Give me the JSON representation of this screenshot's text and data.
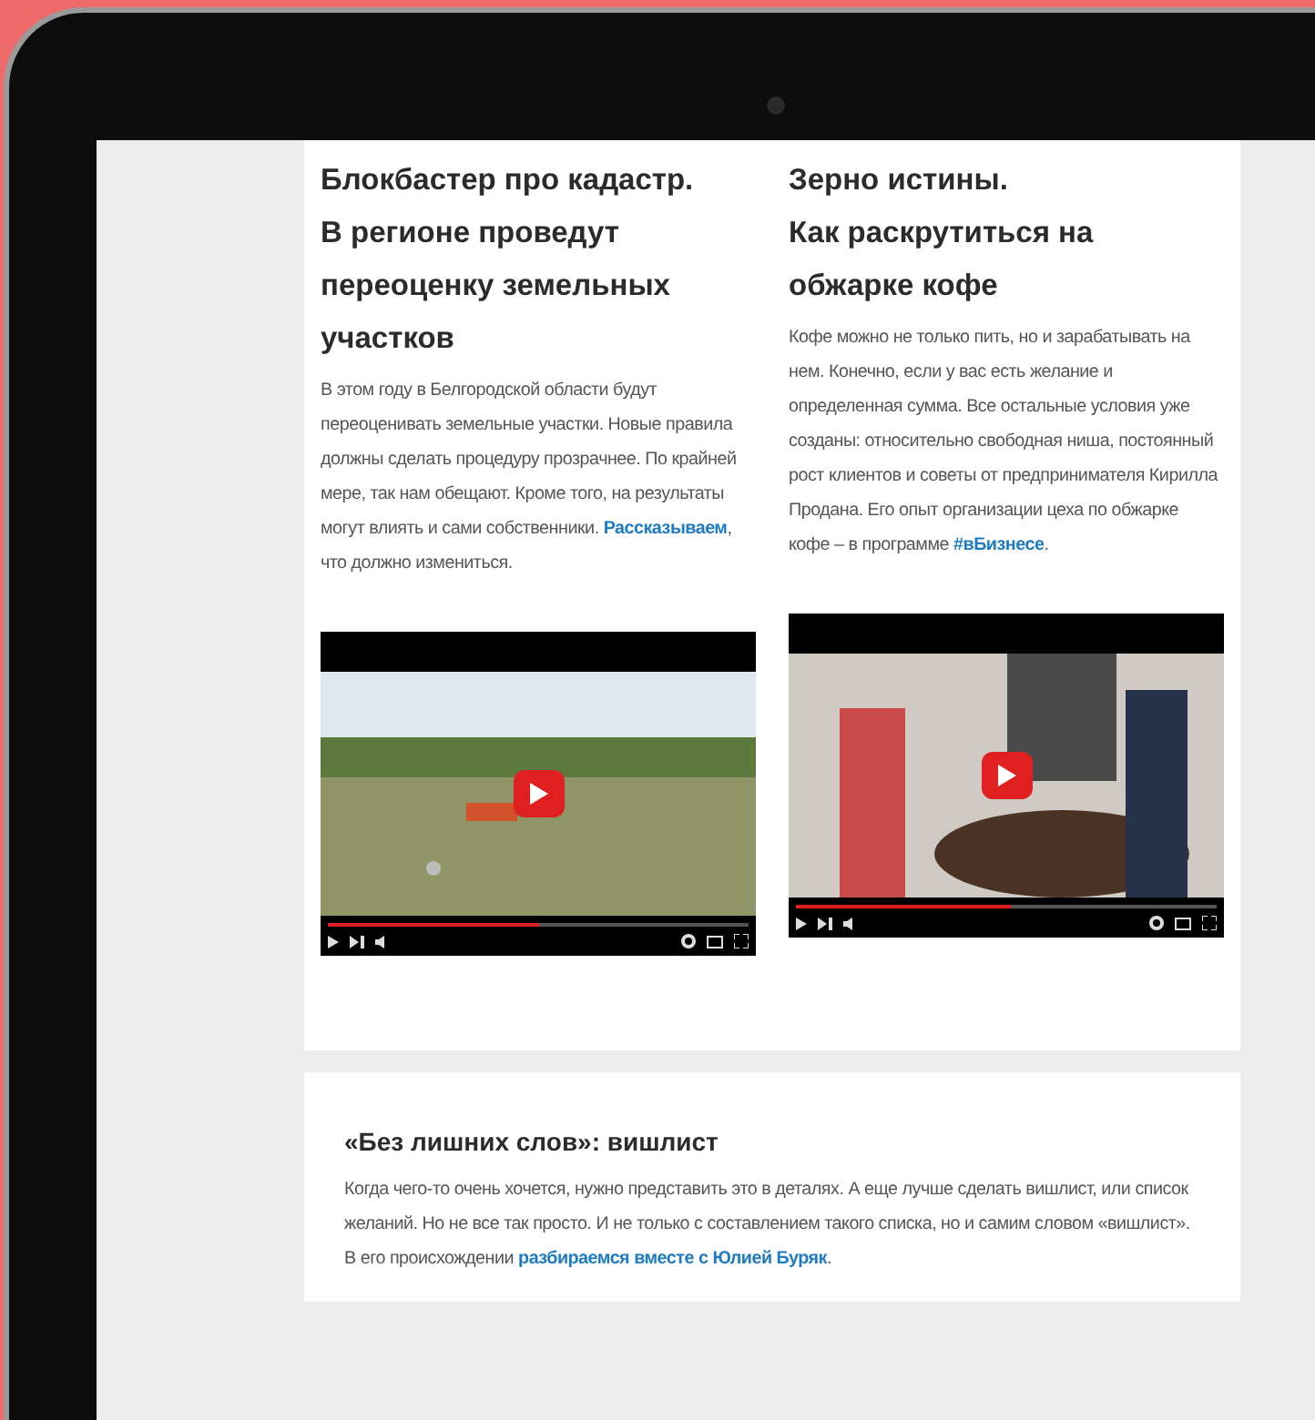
{
  "articles": [
    {
      "title": "Блокбастер про кадастр.\nВ регионе проведут переоценку земельных участков",
      "body": [
        {
          "kind": "text",
          "text": "В этом году в Белгородской области будут переоценивать земельные участки. Новые правила должны сделать процедуру прозрачнее. По крайней мере, так нам обещают. Кроме того, на результаты могут влиять и сами собственники. "
        },
        {
          "kind": "link",
          "text": "Рассказываем"
        },
        {
          "kind": "text",
          "text": ", что должно измениться."
        }
      ],
      "video": {
        "kind": "field",
        "level": 0.5
      }
    },
    {
      "title": "Зерно истины.\nКак раскрутиться на обжарке кофе",
      "body": [
        {
          "kind": "text",
          "text": "Кофе можно не только пить, но и зарабатывать на нем. Конечно, если у вас есть желание и определенная сумма. Все остальные условия уже созданы: относительно свободная ниша, постоянный рост клиентов и советы от предпринимателя Кирилла Продана. Его опыт организации цеха по обжарке кофе – в программе "
        },
        {
          "kind": "link",
          "text": "#вБизнесе"
        },
        {
          "kind": "text",
          "text": "."
        }
      ],
      "video": {
        "kind": "roastery",
        "level": 0.51
      }
    }
  ],
  "feature": {
    "title": "«Без лишних слов»: вишлист",
    "body": [
      {
        "kind": "text",
        "text": "Когда чего-то очень хочется, нужно представить это в деталях. А еще лучше сделать вишлист, или список желаний. Но не все так просто. И не только с составлением такого списка, но и самим словом «вишлист». В его происхождении "
      },
      {
        "kind": "link",
        "text": "разбираемся вместе с Юлией Буряк"
      },
      {
        "kind": "text",
        "text": "."
      }
    ]
  }
}
